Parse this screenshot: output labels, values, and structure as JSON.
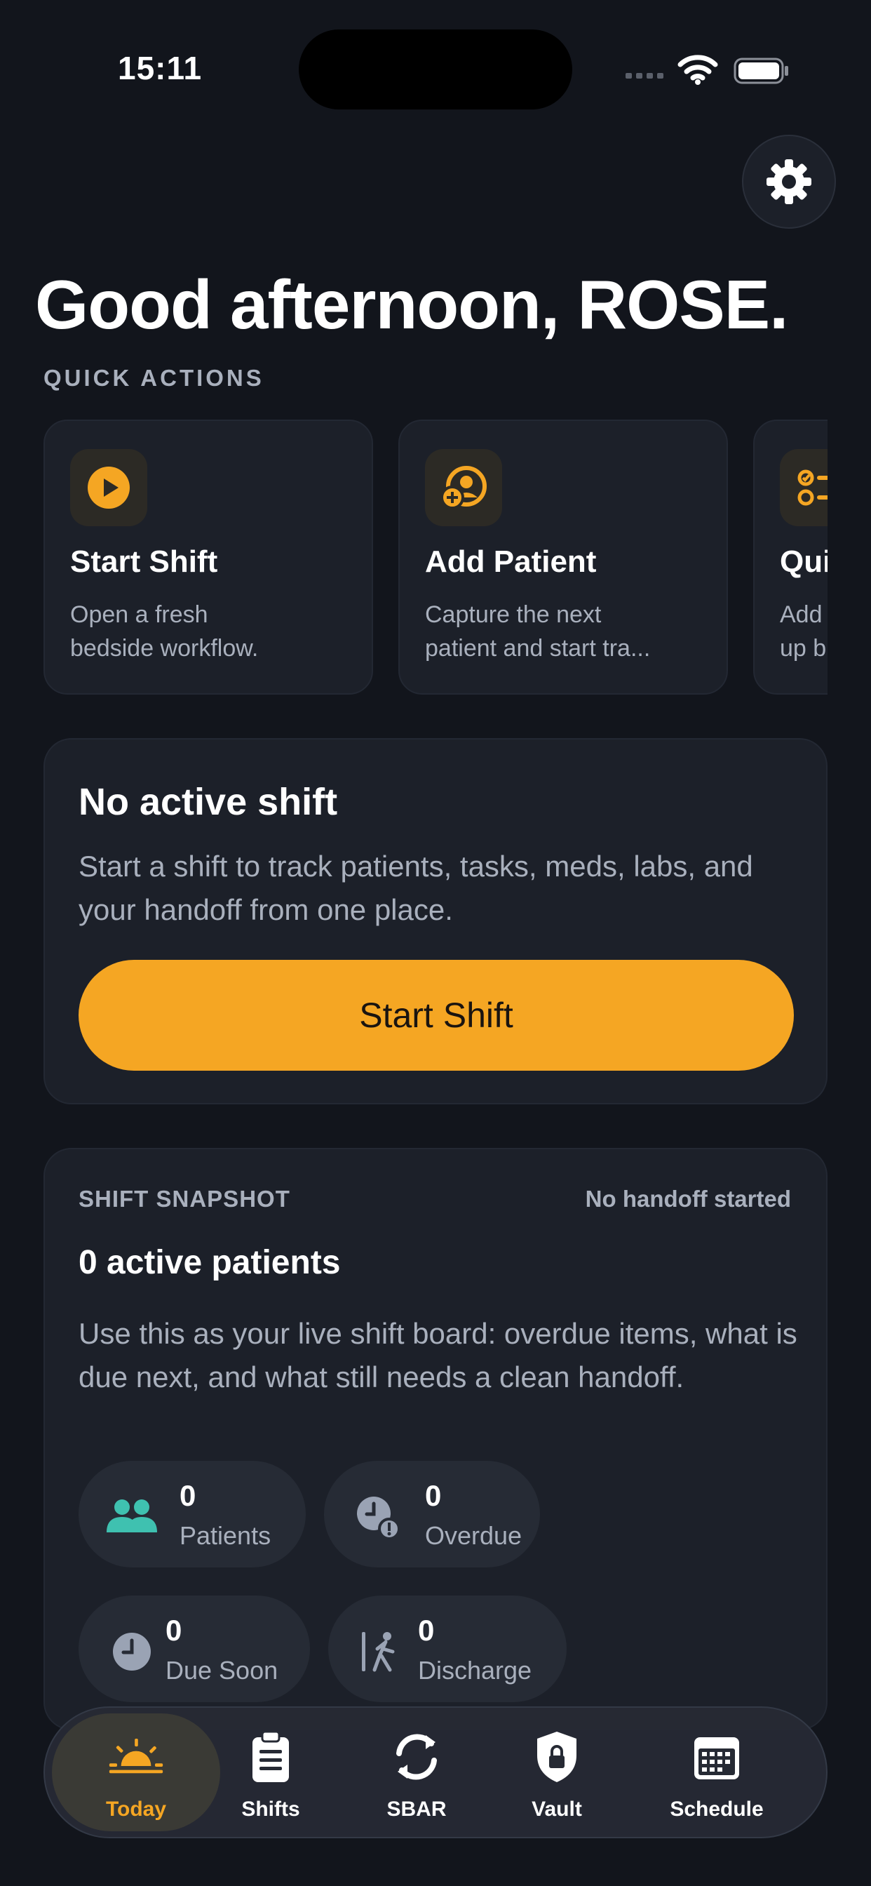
{
  "status_bar": {
    "time": "15:11"
  },
  "greeting": "Good afternoon, ROSE.",
  "quick_actions": {
    "section_label": "QUICK ACTIONS",
    "items": [
      {
        "icon": "play-icon",
        "title": "Start Shift",
        "desc_line1": "Open a fresh",
        "desc_line2": "bedside workflow."
      },
      {
        "icon": "add-patient-icon",
        "title": "Add Patient",
        "desc_line1": "Capture the next",
        "desc_line2": "patient and start tra..."
      },
      {
        "icon": "checklist-icon",
        "title": "Qui",
        "desc_line1": "Add",
        "desc_line2": "up b"
      }
    ]
  },
  "shift_card": {
    "title": "No active shift",
    "description": "Start a shift to track patients, tasks, meds, labs, and your handoff from one place.",
    "button_label": "Start Shift"
  },
  "snapshot": {
    "label": "SHIFT SNAPSHOT",
    "handoff_status": "No handoff started",
    "title": "0 active patients",
    "description": "Use this as your live shift board: overdue items, what is due next, and what still needs a clean handoff.",
    "stats": [
      {
        "icon": "people-icon",
        "value": "0",
        "label": "Patients"
      },
      {
        "icon": "overdue-clock-icon",
        "value": "0",
        "label": "Overdue"
      },
      {
        "icon": "clock-icon",
        "value": "0",
        "label": "Due Soon"
      },
      {
        "icon": "discharge-icon",
        "value": "0",
        "label": "Discharge"
      }
    ]
  },
  "tabbar": {
    "tabs": [
      {
        "icon": "sunrise-icon",
        "label": "Today",
        "active": true
      },
      {
        "icon": "clipboard-icon",
        "label": "Shifts",
        "active": false
      },
      {
        "icon": "sync-icon",
        "label": "SBAR",
        "active": false
      },
      {
        "icon": "shield-lock-icon",
        "label": "Vault",
        "active": false
      },
      {
        "icon": "calendar-icon",
        "label": "Schedule",
        "active": false
      }
    ]
  },
  "colors": {
    "accent": "#f5a623",
    "background": "#12151c",
    "card": "#1c2029",
    "teal": "#3fc1b0"
  }
}
